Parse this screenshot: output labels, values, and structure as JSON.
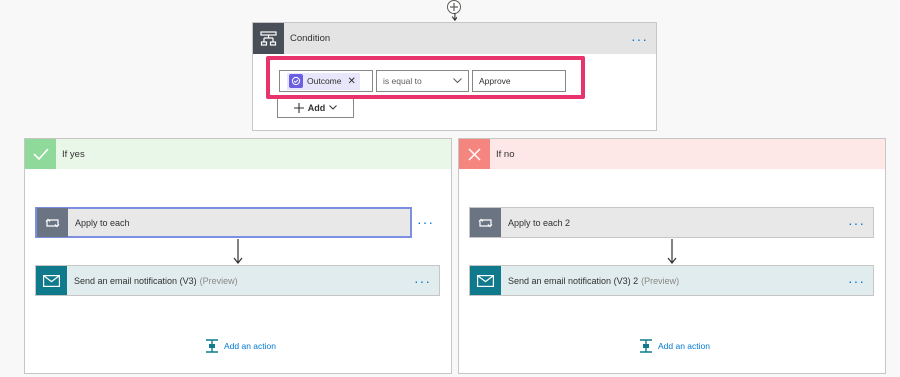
{
  "condition": {
    "title": "Condition",
    "more_label": "···",
    "token_label": "Outcome",
    "token_remove": "✕",
    "operator": "is equal to",
    "value": "Approve",
    "add_label": "Add"
  },
  "branches": {
    "yes": {
      "label": "If yes",
      "apply_label": "Apply to each",
      "email_label": "Send an email notification (V3)",
      "email_preview": "(Preview)",
      "add_action": "Add an action"
    },
    "no": {
      "label": "If no",
      "apply_label": "Apply to each 2",
      "email_label": "Send an email notification (V3) 2",
      "email_preview": "(Preview)",
      "add_action": "Add an action"
    }
  },
  "colors": {
    "highlight": "#e8336d",
    "accent": "#0078d4",
    "yes": "#8fd99a",
    "no": "#f4857f",
    "email": "#0e7a8b"
  },
  "icons": [
    "plus-icon",
    "condition-icon",
    "approval-icon",
    "chevron-down-icon",
    "check-icon",
    "x-icon",
    "loop-icon",
    "mail-icon",
    "add-action-icon"
  ]
}
